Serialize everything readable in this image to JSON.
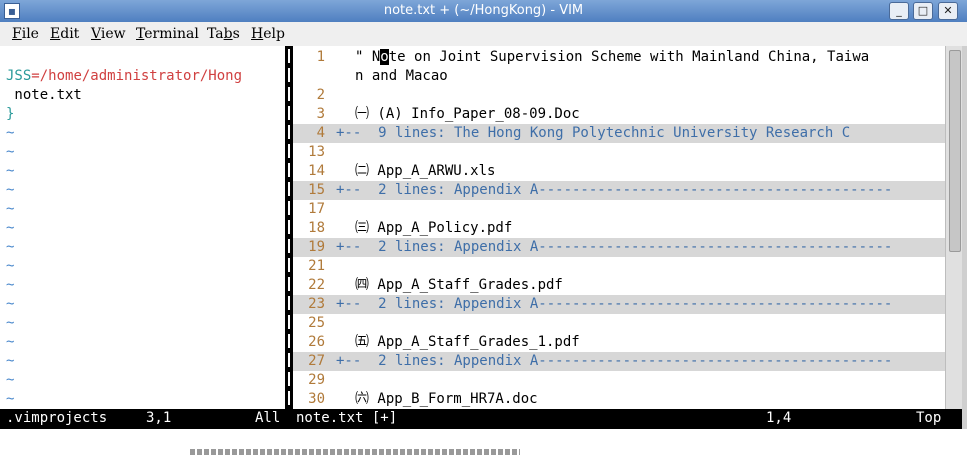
{
  "window": {
    "title": "note.txt + (~/HongKong) - VIM",
    "app_icon": "vim-icon",
    "minimize": "_",
    "maximize": "□",
    "close": "✕"
  },
  "menu": [
    {
      "label": "File",
      "accel": "F",
      "rest": "ile"
    },
    {
      "label": "Edit",
      "accel": "E",
      "rest": "dit"
    },
    {
      "label": "View",
      "accel": "V",
      "rest": "iew"
    },
    {
      "label": "Terminal",
      "accel": "T",
      "rest": "erminal"
    },
    {
      "label": "Tabs",
      "pre": "Ta",
      "accel": "b",
      "rest": "s"
    },
    {
      "label": "Help",
      "accel": "H",
      "rest": "elp"
    }
  ],
  "project_pane": {
    "root_name": "JSS",
    "root_eq": "=",
    "root_path": "/home/administrator/Hong",
    "file": " note.txt",
    "close_brace": "}",
    "tilde": "~"
  },
  "note_lines": [
    {
      "num": "1",
      "pre": "\" N",
      "cursor": "o",
      "post": "te on Joint Supervision Scheme with Mainland China, Taiwa",
      "fold": false
    },
    {
      "num": "",
      "text": "n and Macao",
      "fold": false
    },
    {
      "num": "2",
      "text": "",
      "fold": false
    },
    {
      "num": "3",
      "text": "㈠ (A) Info_Paper_08-09.Doc",
      "fold": false
    },
    {
      "num": "4",
      "text": "+--  9 lines: The Hong Kong Polytechnic University Research C",
      "fold": true
    },
    {
      "num": "13",
      "text": "",
      "fold": false
    },
    {
      "num": "14",
      "text": "㈡ App_A_ARWU.xls",
      "fold": false
    },
    {
      "num": "15",
      "text": "+--  2 lines: Appendix A------------------------------------------",
      "fold": true
    },
    {
      "num": "17",
      "text": "",
      "fold": false
    },
    {
      "num": "18",
      "text": "㈢ App_A_Policy.pdf",
      "fold": false
    },
    {
      "num": "19",
      "text": "+--  2 lines: Appendix A------------------------------------------",
      "fold": true
    },
    {
      "num": "21",
      "text": "",
      "fold": false
    },
    {
      "num": "22",
      "text": "㈣ App_A_Staff_Grades.pdf",
      "fold": false
    },
    {
      "num": "23",
      "text": "+--  2 lines: Appendix A------------------------------------------",
      "fold": true
    },
    {
      "num": "25",
      "text": "",
      "fold": false
    },
    {
      "num": "26",
      "text": "㈤ App_A_Staff_Grades_1.pdf",
      "fold": false
    },
    {
      "num": "27",
      "text": "+--  2 lines: Appendix A------------------------------------------",
      "fold": true
    },
    {
      "num": "29",
      "text": "",
      "fold": false
    },
    {
      "num": "30",
      "text": "㈥ App_B_Form_HR7A.doc",
      "fold": false
    }
  ],
  "status": {
    "left_name": ".vimprojects",
    "left_pos": "3,1",
    "left_pct": "All",
    "right_name": "note.txt [+]",
    "right_pos": "1,4",
    "right_pct": "Top"
  },
  "colors": {
    "title_bar": "#5b8bcb",
    "line_number": "#b07a3a",
    "fold_text": "#3e6ea8",
    "fold_bg": "#d7d7d7",
    "tilde": "#4a88cc",
    "project_path": "#d04040",
    "project_name": "#2a9a9a"
  }
}
